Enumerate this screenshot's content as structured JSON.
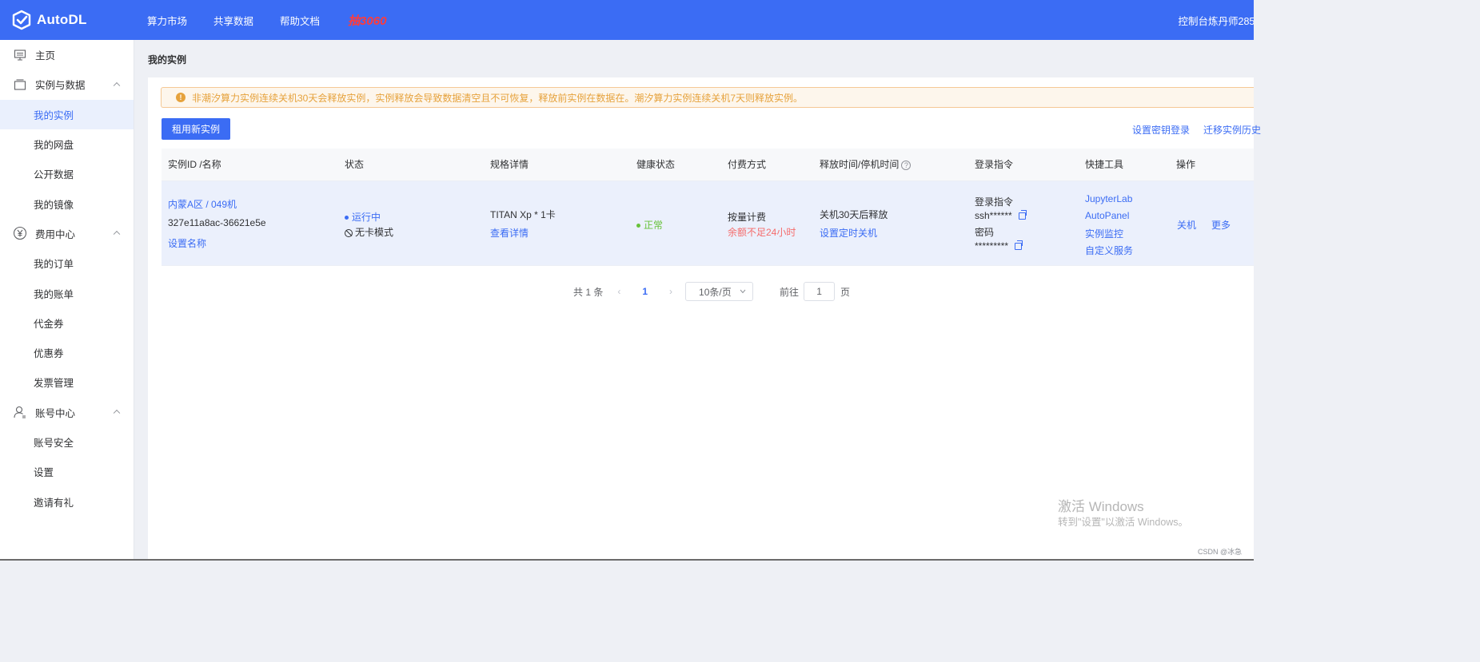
{
  "topbar": {
    "logo_text": "AutoDL",
    "nav": [
      "算力市场",
      "共享数据",
      "帮助文档"
    ],
    "promo": "抽3060",
    "console": "控制台",
    "username": "炼丹师285"
  },
  "sidebar": {
    "home": "主页",
    "group_instances": "实例与数据",
    "my_instances": "我的实例",
    "my_disk": "我的网盘",
    "public_data": "公开数据",
    "my_images": "我的镜像",
    "group_billing": "费用中心",
    "my_orders": "我的订单",
    "my_bills": "我的账单",
    "vouchers": "代金券",
    "coupons": "优惠券",
    "invoices": "发票管理",
    "group_account": "账号中心",
    "account_security": "账号安全",
    "settings": "设置",
    "invite": "邀请有礼"
  },
  "main": {
    "page_title": "我的实例",
    "alert": "非潮汐算力实例连续关机30天会释放实例，实例释放会导致数据清空且不可恢复，释放前实例在数据在。潮汐算力实例连续关机7天则释放实例。",
    "rent_button": "租用新实例",
    "key_login_link": "设置密钥登录",
    "migrate_link": "迁移实例历史"
  },
  "table": {
    "headers": {
      "id_name": "实例ID /名称",
      "status": "状态",
      "spec": "规格详情",
      "health": "健康状态",
      "billing": "付费方式",
      "release_time": "释放时间/停机时间",
      "login": "登录指令",
      "tools": "快捷工具",
      "actions": "操作"
    },
    "row": {
      "region": "内蒙A区 / 049机",
      "instance_id": "327e11a8ac-36621e5e",
      "set_name": "设置名称",
      "status": "运行中",
      "mode": "无卡模式",
      "spec": "TITAN Xp * 1卡",
      "view_details": "查看详情",
      "health": "正常",
      "billing": "按量计费",
      "balance_warning": "余额不足24小时",
      "release": "关机30天后释放",
      "timed_shutdown": "设置定时关机",
      "login_label": "登录指令",
      "ssh": "ssh******",
      "password_label": "密码",
      "password": "*********",
      "tools": [
        "JupyterLab",
        "AutoPanel",
        "实例监控",
        "自定义服务"
      ],
      "shutdown": "关机",
      "more": "更多"
    }
  },
  "pagination": {
    "total": "共 1 条",
    "current_page": "1",
    "page_size": "10条/页",
    "goto_label": "前往",
    "goto_value": "1",
    "page_suffix": "页"
  },
  "watermark": {
    "line1": "激活 Windows",
    "line2": "转到\"设置\"以激活 Windows。",
    "csdn": "CSDN @冰急"
  },
  "colors": {
    "primary": "#3b6cf4",
    "warning": "#e6a23c",
    "success": "#67c23a",
    "danger": "#f56c6c"
  }
}
